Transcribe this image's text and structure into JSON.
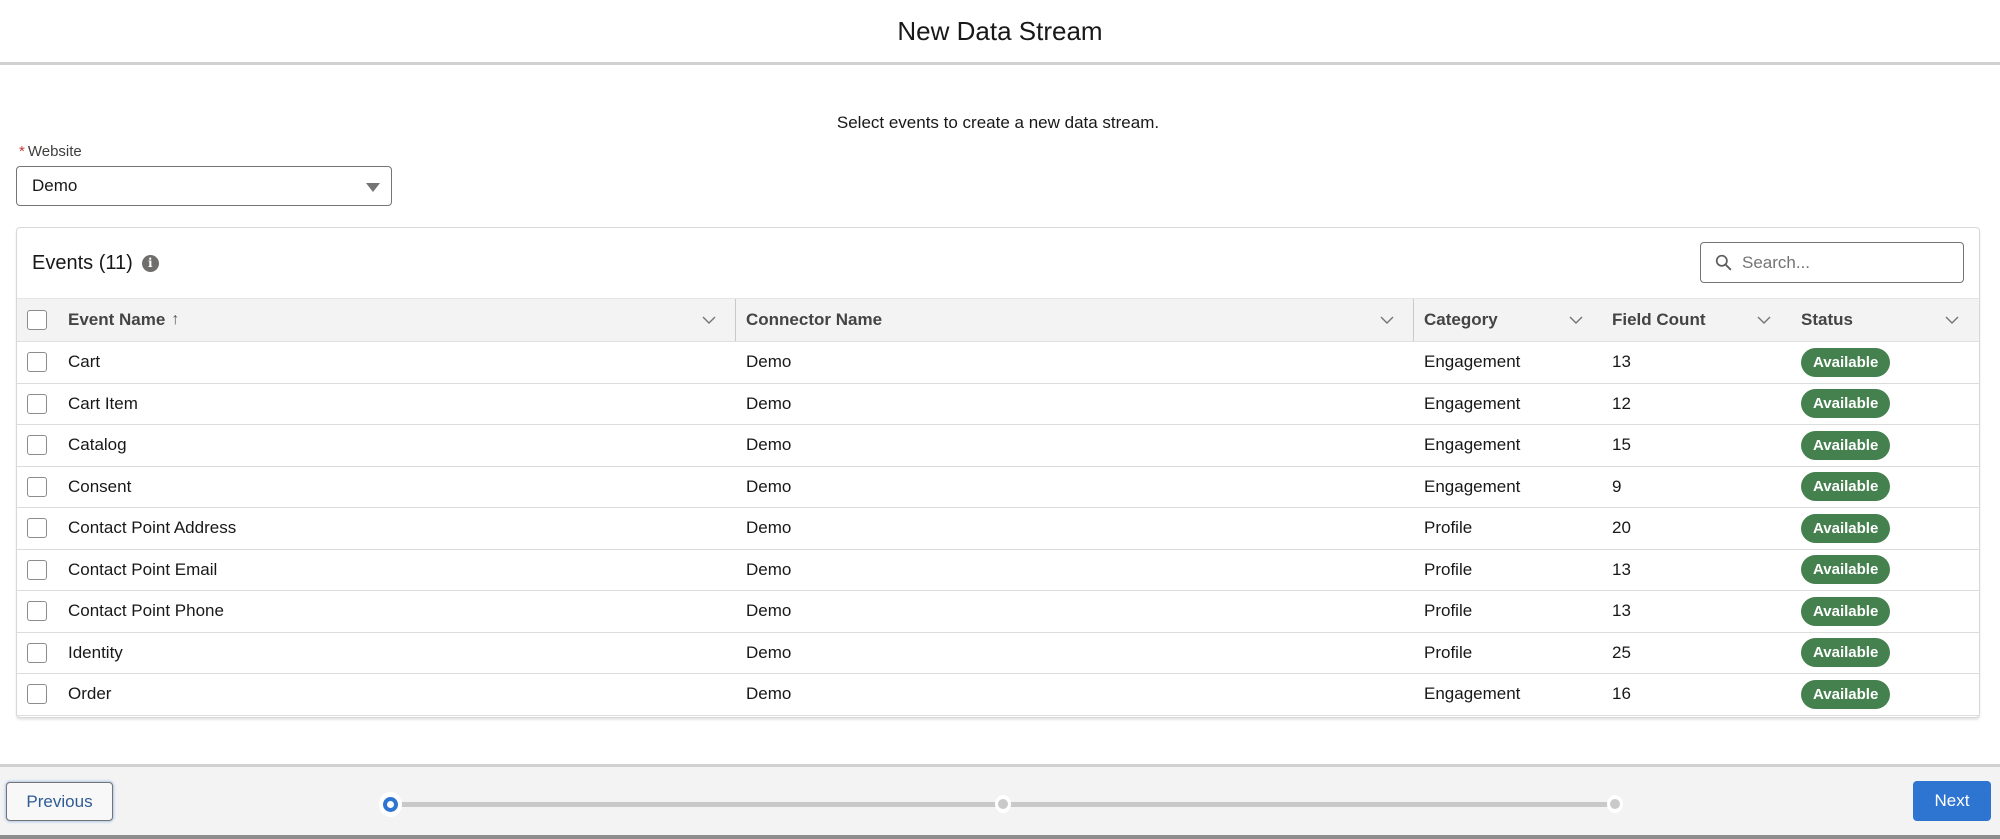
{
  "modal": {
    "title": "New Data Stream",
    "subtitle": "Select events to create a new data stream."
  },
  "website_field": {
    "label": "Website",
    "required_marker": "*",
    "value": "Demo"
  },
  "events_card": {
    "title": "Events (11)",
    "info_icon": "info-icon",
    "search": {
      "placeholder": "Search...",
      "value": ""
    },
    "columns": [
      {
        "label": "Event Name",
        "sort": "ascending",
        "sort_glyph": "↑"
      },
      {
        "label": "Connector Name"
      },
      {
        "label": "Category"
      },
      {
        "label": "Field Count"
      },
      {
        "label": "Status"
      }
    ],
    "rows": [
      {
        "event_name": "Cart",
        "connector": "Demo",
        "category": "Engagement",
        "field_count": "13",
        "status": "Available"
      },
      {
        "event_name": "Cart Item",
        "connector": "Demo",
        "category": "Engagement",
        "field_count": "12",
        "status": "Available"
      },
      {
        "event_name": "Catalog",
        "connector": "Demo",
        "category": "Engagement",
        "field_count": "15",
        "status": "Available"
      },
      {
        "event_name": "Consent",
        "connector": "Demo",
        "category": "Engagement",
        "field_count": "9",
        "status": "Available"
      },
      {
        "event_name": "Contact Point Address",
        "connector": "Demo",
        "category": "Profile",
        "field_count": "20",
        "status": "Available"
      },
      {
        "event_name": "Contact Point Email",
        "connector": "Demo",
        "category": "Profile",
        "field_count": "13",
        "status": "Available"
      },
      {
        "event_name": "Contact Point Phone",
        "connector": "Demo",
        "category": "Profile",
        "field_count": "13",
        "status": "Available"
      },
      {
        "event_name": "Identity",
        "connector": "Demo",
        "category": "Profile",
        "field_count": "25",
        "status": "Available"
      },
      {
        "event_name": "Order",
        "connector": "Demo",
        "category": "Engagement",
        "field_count": "16",
        "status": "Available"
      }
    ]
  },
  "footer": {
    "previous_label": "Previous",
    "next_label": "Next",
    "progress": {
      "total_steps": 3,
      "current_step": 1
    }
  },
  "colors": {
    "brand_blue": "#2e74d1",
    "status_available": "#45814f",
    "required_red": "#c23934"
  }
}
